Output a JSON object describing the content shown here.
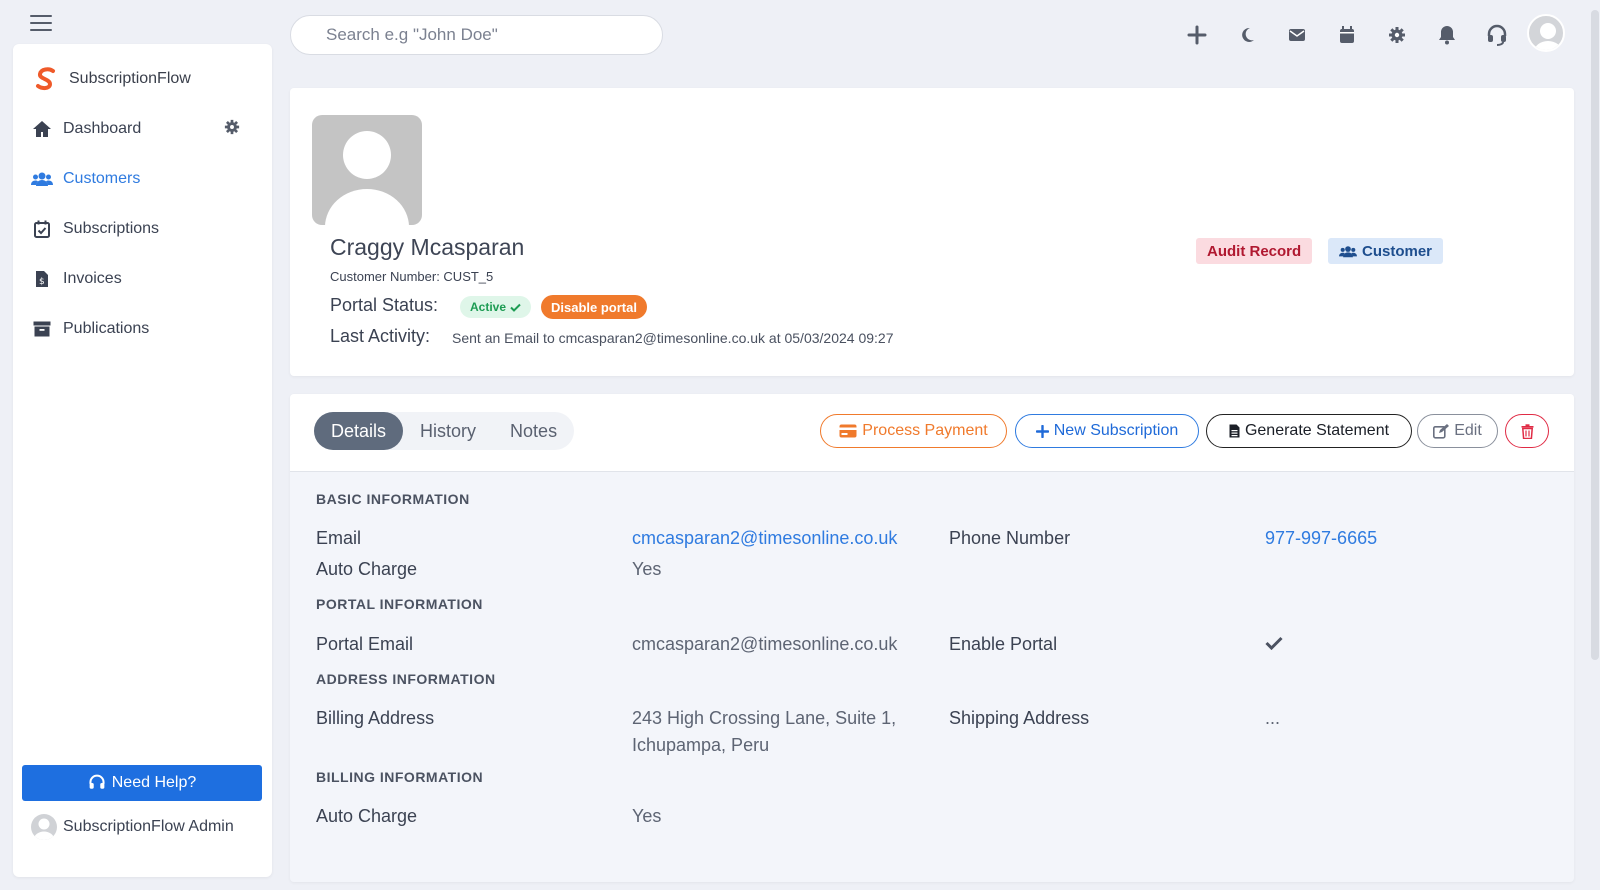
{
  "search": {
    "placeholder": "Search e.g \"John Doe\""
  },
  "sidebar": {
    "brand": "SubscriptionFlow",
    "items": [
      {
        "label": "Dashboard",
        "icon": "home-icon"
      },
      {
        "label": "Customers",
        "icon": "users-icon",
        "active": true
      },
      {
        "label": "Subscriptions",
        "icon": "calendar-check-icon"
      },
      {
        "label": "Invoices",
        "icon": "invoice-icon"
      },
      {
        "label": "Publications",
        "icon": "archive-icon"
      }
    ],
    "help_label": "Need Help?",
    "admin_name": "SubscriptionFlow Admin"
  },
  "profile": {
    "name": "Craggy Mcasparan",
    "customer_number_label": "Customer Number: CUST_5",
    "portal_status_label": "Portal Status:",
    "portal_status": "Active",
    "disable_portal_label": "Disable portal",
    "last_activity_label": "Last Activity:",
    "last_activity": "Sent an Email to cmcasparan2@timesonline.co.uk at 05/03/2024 09:27",
    "audit_label": "Audit Record",
    "customer_tag": "Customer"
  },
  "tabs": [
    "Details",
    "History",
    "Notes"
  ],
  "actions": {
    "process_payment": "Process Payment",
    "new_subscription": "New Subscription",
    "generate_statement": "Generate Statement",
    "edit": "Edit"
  },
  "details": {
    "basic_title": "BASIC INFORMATION",
    "email_label": "Email",
    "email": "cmcasparan2@timesonline.co.uk",
    "phone_label": "Phone Number",
    "phone": "977-997-6665",
    "auto_charge_label": "Auto Charge",
    "auto_charge": "Yes",
    "portal_title": "PORTAL INFORMATION",
    "portal_email_label": "Portal Email",
    "portal_email": "cmcasparan2@timesonline.co.uk",
    "enable_portal_label": "Enable Portal",
    "address_title": "ADDRESS INFORMATION",
    "billing_address_label": "Billing Address",
    "billing_address_line1": "243 High Crossing Lane, Suite 1,",
    "billing_address_line2": "Ichupampa, Peru",
    "shipping_address_label": "Shipping Address",
    "shipping_address": "...",
    "billing_title": "BILLING INFORMATION",
    "billing_auto_charge_label": "Auto Charge",
    "billing_auto_charge": "Yes"
  },
  "colors": {
    "accent": "#2f7be0",
    "orange": "#f07a2c",
    "danger": "#e02b45",
    "active_green": "#1d9c53"
  }
}
